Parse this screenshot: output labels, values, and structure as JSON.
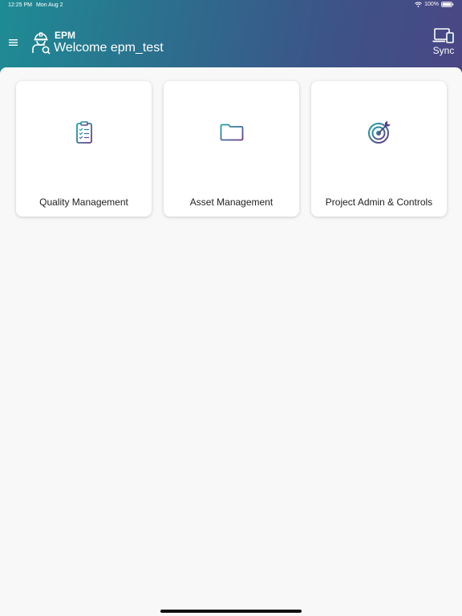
{
  "status_bar": {
    "time": "12:25 PM",
    "date": "Mon Aug 2",
    "battery": "100%",
    "wifi_icon": "wifi-icon",
    "battery_icon": "battery-icon"
  },
  "header": {
    "menu_icon": "hamburger-menu-icon",
    "brand_icon": "engineer-helmet-icon",
    "app_name": "EPM",
    "welcome": "Welcome epm_test",
    "sync_icon": "devices-icon",
    "sync_label": "Sync"
  },
  "colors": {
    "header_gradient_start": "#1e8c94",
    "header_gradient_end": "#4a4684",
    "icon_teal": "#1aa5a5",
    "icon_purple": "#6a3a8a",
    "background": "#f8f8f9"
  },
  "cards": [
    {
      "label": "Quality Management",
      "icon": "clipboard-checklist-icon"
    },
    {
      "label": "Asset Management",
      "icon": "folder-icon"
    },
    {
      "label": "Project Admin & Controls",
      "icon": "target-icon"
    }
  ]
}
